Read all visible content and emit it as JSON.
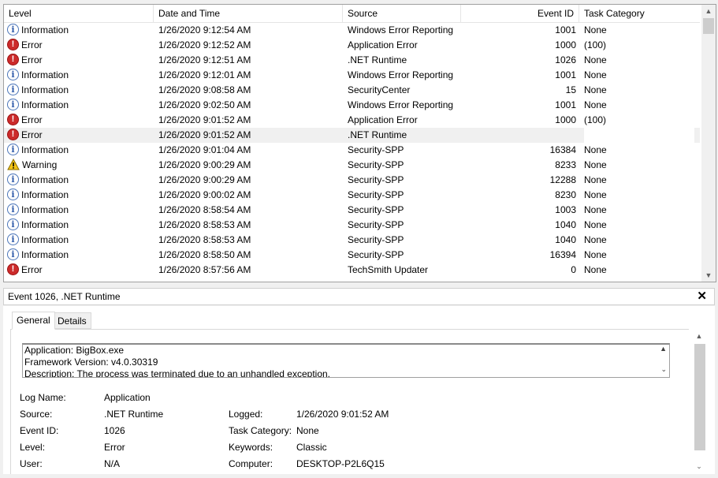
{
  "list": {
    "columns": [
      "Level",
      "Date and Time",
      "Source",
      "Event ID",
      "Task Category"
    ],
    "rows": [
      {
        "icon": "info",
        "level": "Information",
        "date": "1/26/2020 9:12:54 AM",
        "source": "Windows Error Reporting",
        "id": "1001",
        "cat": "None"
      },
      {
        "icon": "error",
        "level": "Error",
        "date": "1/26/2020 9:12:52 AM",
        "source": "Application Error",
        "id": "1000",
        "cat": "(100)"
      },
      {
        "icon": "error",
        "level": "Error",
        "date": "1/26/2020 9:12:51 AM",
        "source": ".NET Runtime",
        "id": "1026",
        "cat": "None"
      },
      {
        "icon": "info",
        "level": "Information",
        "date": "1/26/2020 9:12:01 AM",
        "source": "Windows Error Reporting",
        "id": "1001",
        "cat": "None"
      },
      {
        "icon": "info",
        "level": "Information",
        "date": "1/26/2020 9:08:58 AM",
        "source": "SecurityCenter",
        "id": "15",
        "cat": "None"
      },
      {
        "icon": "info",
        "level": "Information",
        "date": "1/26/2020 9:02:50 AM",
        "source": "Windows Error Reporting",
        "id": "1001",
        "cat": "None"
      },
      {
        "icon": "error",
        "level": "Error",
        "date": "1/26/2020 9:01:52 AM",
        "source": "Application Error",
        "id": "1000",
        "cat": "(100)"
      },
      {
        "icon": "error",
        "level": "Error",
        "date": "1/26/2020 9:01:52 AM",
        "source": ".NET Runtime",
        "id": "",
        "cat": "",
        "selected": true
      },
      {
        "icon": "info",
        "level": "Information",
        "date": "1/26/2020 9:01:04 AM",
        "source": "Security-SPP",
        "id": "16384",
        "cat": "None"
      },
      {
        "icon": "warning",
        "level": "Warning",
        "date": "1/26/2020 9:00:29 AM",
        "source": "Security-SPP",
        "id": "8233",
        "cat": "None"
      },
      {
        "icon": "info",
        "level": "Information",
        "date": "1/26/2020 9:00:29 AM",
        "source": "Security-SPP",
        "id": "12288",
        "cat": "None"
      },
      {
        "icon": "info",
        "level": "Information",
        "date": "1/26/2020 9:00:02 AM",
        "source": "Security-SPP",
        "id": "8230",
        "cat": "None"
      },
      {
        "icon": "info",
        "level": "Information",
        "date": "1/26/2020 8:58:54 AM",
        "source": "Security-SPP",
        "id": "1003",
        "cat": "None"
      },
      {
        "icon": "info",
        "level": "Information",
        "date": "1/26/2020 8:58:53 AM",
        "source": "Security-SPP",
        "id": "1040",
        "cat": "None"
      },
      {
        "icon": "info",
        "level": "Information",
        "date": "1/26/2020 8:58:53 AM",
        "source": "Security-SPP",
        "id": "1040",
        "cat": "None"
      },
      {
        "icon": "info",
        "level": "Information",
        "date": "1/26/2020 8:58:50 AM",
        "source": "Security-SPP",
        "id": "16394",
        "cat": "None"
      },
      {
        "icon": "error",
        "level": "Error",
        "date": "1/26/2020 8:57:56 AM",
        "source": "TechSmith Updater",
        "id": "0",
        "cat": "None"
      }
    ]
  },
  "detail": {
    "title": "Event 1026, .NET Runtime",
    "tabs": [
      "General",
      "Details"
    ],
    "description_lines": [
      "Application: BigBox.exe",
      "Framework Version: v4.0.30319",
      "Description: The process was terminated due to an unhandled exception."
    ],
    "fields": {
      "log_name_label": "Log Name:",
      "log_name": "Application",
      "source_label": "Source:",
      "source": ".NET Runtime",
      "logged_label": "Logged:",
      "logged": "1/26/2020 9:01:52 AM",
      "event_id_label": "Event ID:",
      "event_id": "1026",
      "task_category_label": "Task Category:",
      "task_category": "None",
      "level_label": "Level:",
      "level": "Error",
      "keywords_label": "Keywords:",
      "keywords": "Classic",
      "user_label": "User:",
      "user": "N/A",
      "computer_label": "Computer:",
      "computer": "DESKTOP-P2L6Q15"
    }
  },
  "colors": {
    "error": "#cc2b2b",
    "info": "#2c58a8",
    "warning": "#f5c518",
    "selected_row": "#f0f0f0"
  }
}
